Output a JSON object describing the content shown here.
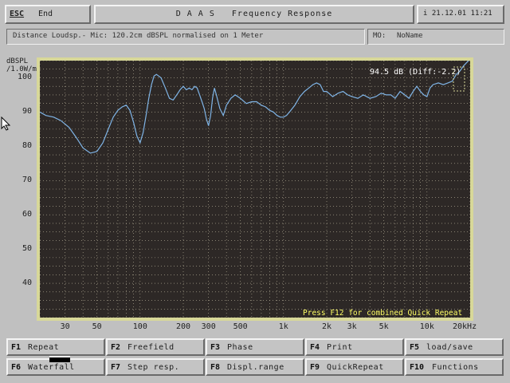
{
  "header": {
    "esc_key": "ESC",
    "esc_label": "End",
    "title": "D A A S   Frequency Response",
    "datetime": "i 21.12.01 11:21"
  },
  "info": {
    "description": "Distance Loudsp.- Mic: 120.2cm dBSPL normalised on 1 Meter",
    "mo_label": "MO:",
    "mo_value": "NoName"
  },
  "chart_data": {
    "type": "line",
    "ylabel": "dBSPL /1.0W/m",
    "ylim": [
      30,
      105
    ],
    "yticks": [
      40,
      50,
      60,
      70,
      80,
      90,
      100
    ],
    "xlim": [
      20,
      20000
    ],
    "xscale": "log",
    "xticks": [
      {
        "v": 30,
        "label": "30"
      },
      {
        "v": 50,
        "label": "50"
      },
      {
        "v": 100,
        "label": "100"
      },
      {
        "v": 200,
        "label": "200"
      },
      {
        "v": 300,
        "label": "300"
      },
      {
        "v": 500,
        "label": "500"
      },
      {
        "v": 1000,
        "label": "1k"
      },
      {
        "v": 2000,
        "label": "2k"
      },
      {
        "v": 3000,
        "label": "3k"
      },
      {
        "v": 5000,
        "label": "5k"
      },
      {
        "v": 10000,
        "label": "10k"
      },
      {
        "v": 20000,
        "label": "20kHz"
      }
    ],
    "readout": "94.5 dB (Diff:-2.2)",
    "hint": "Press F12 for combined Quick Repeat",
    "grid": true,
    "colors": {
      "background": "#2d2826",
      "line": "#7fb4e6",
      "grid": "#bfb8a0",
      "hint": "#ffff66",
      "frame": "#d8d898"
    },
    "series": [
      {
        "x": [
          20,
          22,
          25,
          28,
          32,
          36,
          40,
          45,
          50,
          55,
          60,
          65,
          70,
          75,
          80,
          85,
          90,
          95,
          100,
          105,
          110,
          115,
          120,
          125,
          130,
          140,
          150,
          160,
          170,
          180,
          190,
          200,
          210,
          220,
          230,
          240,
          250,
          260,
          270,
          280,
          290,
          300,
          310,
          320,
          330,
          340,
          360,
          380,
          400,
          430,
          460,
          500,
          550,
          600,
          650,
          700,
          750,
          800,
          850,
          900,
          950,
          1000,
          1050,
          1100,
          1200,
          1300,
          1400,
          1500,
          1600,
          1700,
          1800,
          1900,
          2000,
          2200,
          2400,
          2600,
          2800,
          3000,
          3300,
          3600,
          4000,
          4400,
          4800,
          5200,
          5600,
          6000,
          6500,
          7000,
          7500,
          8000,
          8500,
          9000,
          9500,
          10000,
          10500,
          11000,
          12000,
          13000,
          14000,
          15000,
          16000,
          17000,
          18000,
          19000,
          20000
        ],
        "y": [
          90,
          89,
          88.5,
          87.5,
          85.5,
          82.5,
          79.5,
          78,
          78.5,
          81,
          85,
          88.5,
          90.5,
          91.5,
          92,
          90.5,
          87,
          83,
          81,
          84,
          89,
          94,
          98,
          100.5,
          101,
          100,
          97,
          94,
          93.5,
          95,
          96.5,
          97.5,
          96.5,
          97,
          96.5,
          97.5,
          97,
          95,
          93,
          91,
          88,
          86,
          89,
          94,
          97,
          95,
          91,
          89,
          92,
          94,
          95,
          94,
          92.5,
          93,
          93,
          92,
          91.5,
          90.5,
          90,
          89,
          88.5,
          88.5,
          89,
          90,
          92,
          94.5,
          96,
          97,
          98,
          98.5,
          98,
          96,
          96,
          94.5,
          95.5,
          96,
          95,
          94.5,
          94,
          95,
          94,
          94.5,
          95.5,
          95,
          95,
          94,
          96,
          95,
          94,
          96,
          97.5,
          96,
          95,
          94.5,
          97,
          98,
          98.5,
          98,
          98.5,
          99,
          101,
          102,
          103.5,
          104.5,
          105.5
        ]
      }
    ]
  },
  "fkeys": [
    {
      "key": "F1",
      "label": "Repeat"
    },
    {
      "key": "F2",
      "label": "Freefield"
    },
    {
      "key": "F3",
      "label": "Phase"
    },
    {
      "key": "F4",
      "label": "Print"
    },
    {
      "key": "F5",
      "label": "load/save"
    },
    {
      "key": "F6",
      "label": "Waterfall"
    },
    {
      "key": "F7",
      "label": "Step resp."
    },
    {
      "key": "F8",
      "label": "Displ.range"
    },
    {
      "key": "F9",
      "label": "QuickRepeat"
    },
    {
      "key": "F10",
      "label": "Functions"
    }
  ]
}
